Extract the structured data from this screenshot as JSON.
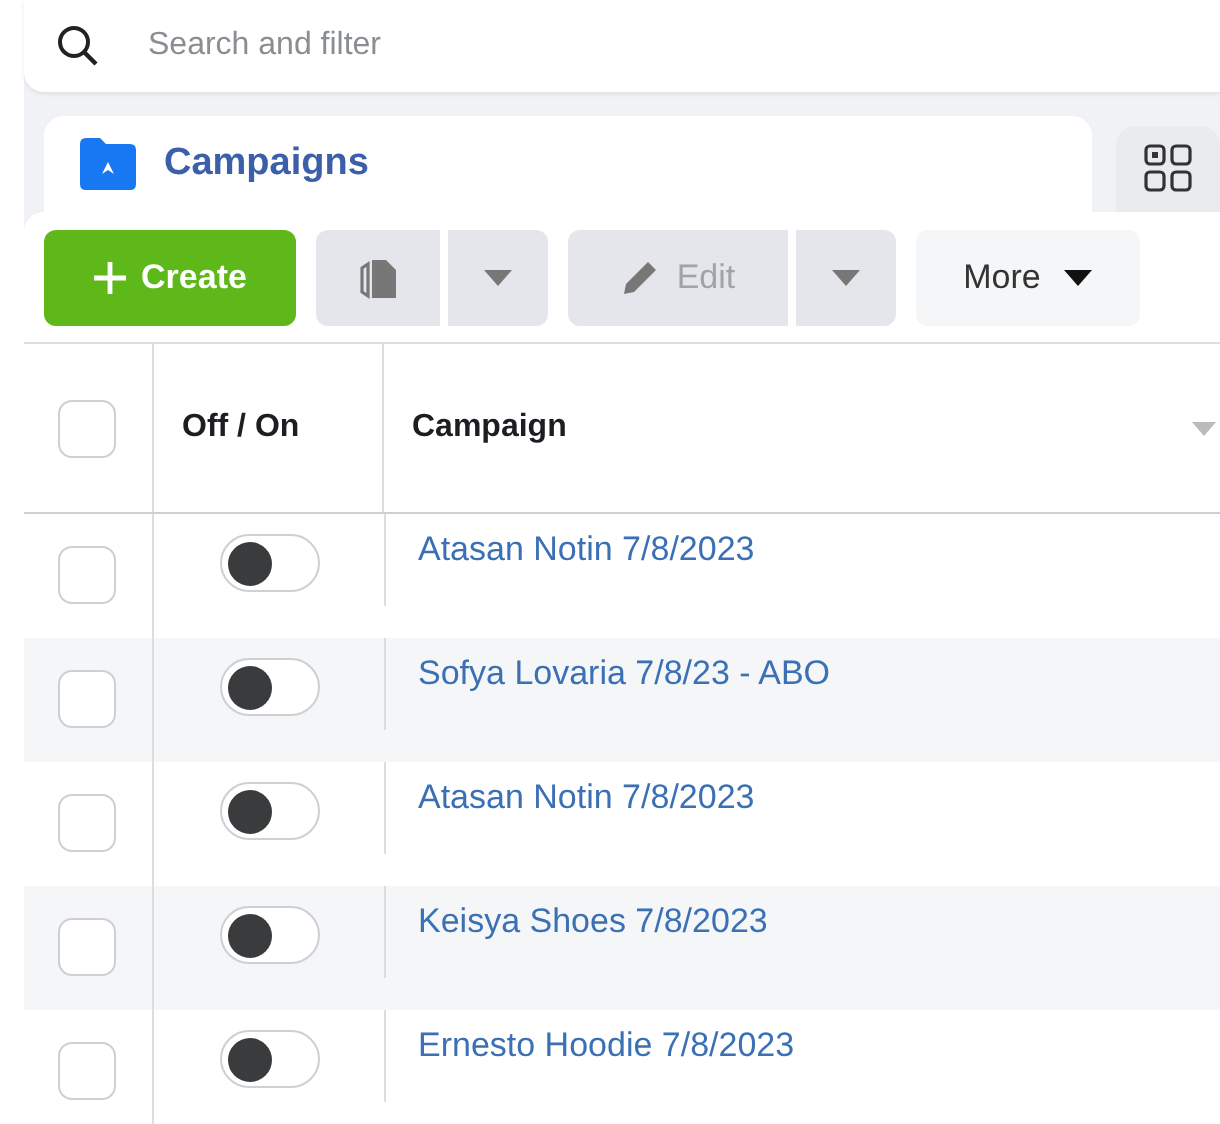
{
  "search": {
    "placeholder": "Search and filter"
  },
  "tabs": [
    {
      "kind": "campaigns",
      "label": "Campaigns",
      "selected": true
    },
    {
      "kind": "grid",
      "selected": false
    }
  ],
  "toolbar": {
    "create": {
      "label": "Create"
    },
    "duplicate": {
      "disabled": true
    },
    "edit": {
      "label": "Edit",
      "disabled": true
    },
    "more": {
      "label": "More"
    }
  },
  "table": {
    "select_all": {
      "checked": false
    },
    "columns": [
      "Off / On",
      "Campaign"
    ],
    "rows": [
      {
        "checked": false,
        "on": false,
        "name": "Atasan Notin 7/8/2023"
      },
      {
        "checked": false,
        "on": false,
        "name": "Sofya Lovaria 7/8/23 - ABO"
      },
      {
        "checked": false,
        "on": false,
        "name": "Atasan Notin 7/8/2023"
      },
      {
        "checked": false,
        "on": false,
        "name": "Keisya Shoes 7/8/2023"
      },
      {
        "checked": false,
        "on": false,
        "name": "Ernesto Hoodie 7/8/2023"
      }
    ]
  }
}
